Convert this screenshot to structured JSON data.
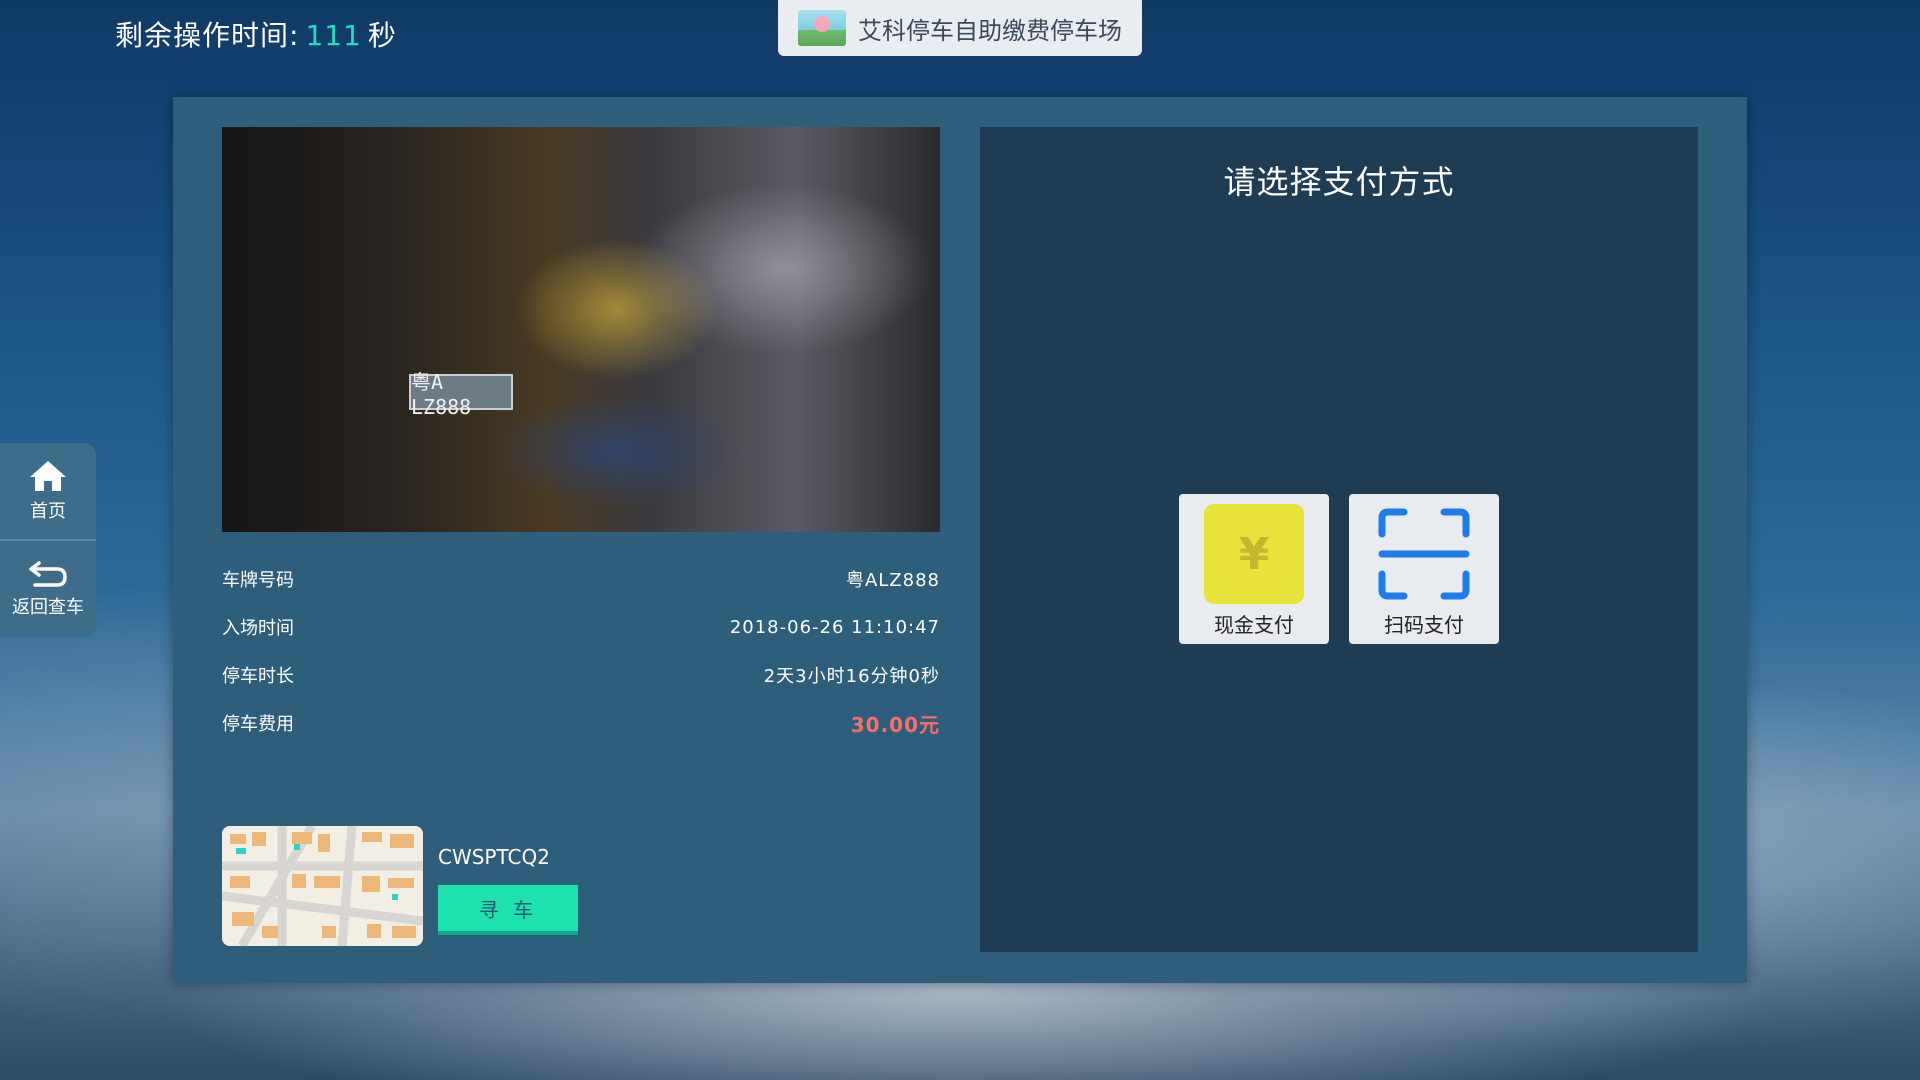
{
  "timer": {
    "label": "剩余操作时间:",
    "value": "111",
    "unit": "秒"
  },
  "header": {
    "title": "艾科停车自助缴费停车场"
  },
  "sidebar": {
    "home_label": "首页",
    "back_label": "返回查车"
  },
  "snapshot": {
    "plate_text": "粤A LZ888"
  },
  "info": [
    {
      "label": "车牌号码",
      "value": "粤ALZ888"
    },
    {
      "label": "入场时间",
      "value": "2018-06-26 11:10:47"
    },
    {
      "label": "停车时长",
      "value": "2天3小时16分钟0秒"
    },
    {
      "label": "停车费用",
      "value": "30.00元"
    }
  ],
  "spot": {
    "code": "CWSPTCQ2",
    "find_label": "寻 车"
  },
  "payment": {
    "title": "请选择支付方式",
    "cash_label": "现金支付",
    "cash_symbol": "¥",
    "scan_label": "扫码支付"
  },
  "colors": {
    "accent": "#1de0c2",
    "fee": "#ff6b6b",
    "find_button": "#1de2b0",
    "cash_icon": "#e8e23a",
    "scan_icon": "#1e7de8"
  }
}
